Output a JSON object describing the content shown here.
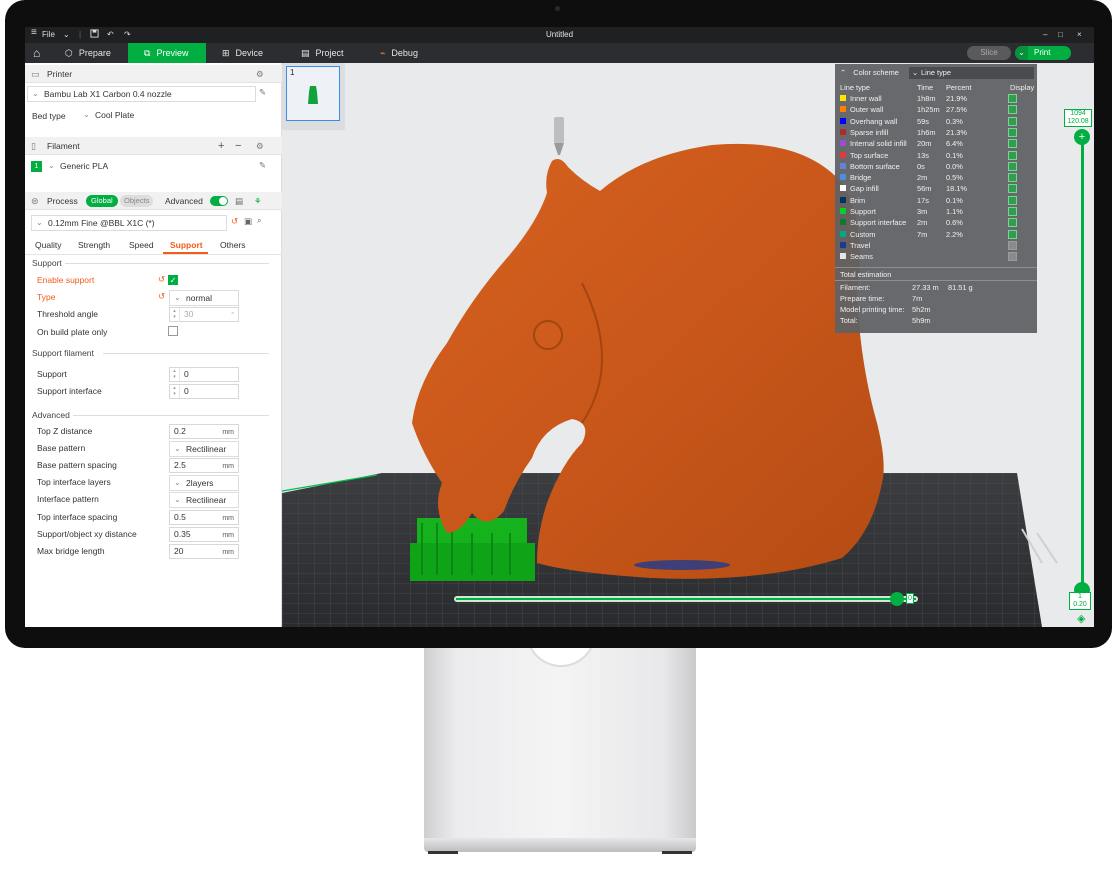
{
  "window": {
    "title": "Untitled",
    "file_menu": "File"
  },
  "nav": {
    "tabs": [
      {
        "label": "Prepare",
        "icon": "cube-icon"
      },
      {
        "label": "Preview",
        "icon": "layers-icon",
        "active": true
      },
      {
        "label": "Device",
        "icon": "device-icon"
      },
      {
        "label": "Project",
        "icon": "project-icon"
      },
      {
        "label": "Debug",
        "icon": "debug-icon"
      }
    ],
    "slice_label": "Slice",
    "print_label": "Print"
  },
  "printer": {
    "section_label": "Printer",
    "model": "Bambu Lab X1 Carbon 0.4 nozzle",
    "bed_type_label": "Bed type",
    "bed_type_value": "Cool Plate"
  },
  "filament": {
    "section_label": "Filament",
    "slot_number": "1",
    "name": "Generic PLA"
  },
  "process": {
    "section_label": "Process",
    "toggle_global": "Global",
    "toggle_objects": "Objects",
    "advanced_label": "Advanced",
    "preset": "0.12mm Fine @BBL X1C (*)",
    "tabs": [
      "Quality",
      "Strength",
      "Speed",
      "Support",
      "Others"
    ],
    "active_tab": "Support"
  },
  "support_group": {
    "title": "Support",
    "enable_support_label": "Enable support",
    "type_label": "Type",
    "type_value": "normal",
    "threshold_label": "Threshold angle",
    "threshold_value": "30",
    "build_plate_only_label": "On build plate only"
  },
  "support_filament_group": {
    "title": "Support filament",
    "support_label": "Support",
    "support_value": "0",
    "interface_label": "Support interface",
    "interface_value": "0"
  },
  "advanced_group": {
    "title": "Advanced",
    "rows": [
      {
        "label": "Top Z distance",
        "value": "0.2",
        "unit": "mm",
        "kind": "field"
      },
      {
        "label": "Base pattern",
        "value": "Rectilinear",
        "unit": "",
        "kind": "combo"
      },
      {
        "label": "Base pattern spacing",
        "value": "2.5",
        "unit": "mm",
        "kind": "field"
      },
      {
        "label": "Top interface layers",
        "value": "2",
        "unit": "layers",
        "kind": "combo"
      },
      {
        "label": "Interface pattern",
        "value": "Rectilinear",
        "unit": "",
        "kind": "combo"
      },
      {
        "label": "Top interface spacing",
        "value": "0.5",
        "unit": "mm",
        "kind": "field"
      },
      {
        "label": "Support/object xy distance",
        "value": "0.35",
        "unit": "mm",
        "kind": "field"
      },
      {
        "label": "Max bridge length",
        "value": "20",
        "unit": "mm",
        "kind": "field"
      }
    ]
  },
  "plate_thumbnail": {
    "number": "1"
  },
  "legend": {
    "color_scheme_label": "Color scheme",
    "color_scheme_value": "Line type",
    "headers": {
      "type": "Line type",
      "time": "Time",
      "percent": "Percent",
      "display": "Display"
    },
    "rows": [
      {
        "name": "Inner wall",
        "time": "1h8m",
        "percent": "21.9%",
        "color": "#FFE600",
        "display": true
      },
      {
        "name": "Outer wall",
        "time": "1h25m",
        "percent": "27.5%",
        "color": "#FF7F00",
        "display": true
      },
      {
        "name": "Overhang wall",
        "time": "59s",
        "percent": "0.3%",
        "color": "#0000FF",
        "display": true
      },
      {
        "name": "Sparse infill",
        "time": "1h6m",
        "percent": "21.3%",
        "color": "#B02A2A",
        "display": true
      },
      {
        "name": "Internal solid infill",
        "time": "20m",
        "percent": "6.4%",
        "color": "#9A4FD0",
        "display": true
      },
      {
        "name": "Top surface",
        "time": "13s",
        "percent": "0.1%",
        "color": "#E23A3A",
        "display": true
      },
      {
        "name": "Bottom surface",
        "time": "0s",
        "percent": "0.0%",
        "color": "#6A7FD8",
        "display": true
      },
      {
        "name": "Bridge",
        "time": "2m",
        "percent": "0.5%",
        "color": "#4F8FE0",
        "display": true
      },
      {
        "name": "Gap infill",
        "time": "56m",
        "percent": "18.1%",
        "color": "#FFFFFF",
        "display": true
      },
      {
        "name": "Brim",
        "time": "17s",
        "percent": "0.1%",
        "color": "#003366",
        "display": true
      },
      {
        "name": "Support",
        "time": "3m",
        "percent": "1.1%",
        "color": "#00D22A",
        "display": true
      },
      {
        "name": "Support interface",
        "time": "2m",
        "percent": "0.6%",
        "color": "#0F7A2A",
        "display": true
      },
      {
        "name": "Custom",
        "time": "7m",
        "percent": "2.2%",
        "color": "#00A88A",
        "display": true
      },
      {
        "name": "Travel",
        "time": "",
        "percent": "",
        "color": "#1A3B8F",
        "display": false
      },
      {
        "name": "Seams",
        "time": "",
        "percent": "",
        "color": "#E6E6E6",
        "display": false
      }
    ],
    "total_title": "Total estimation",
    "filament_label": "Filament:",
    "filament_length": "27.33 m",
    "filament_weight": "81.51 g",
    "prepare_label": "Prepare time:",
    "prepare_value": "7m",
    "model_time_label": "Model printing time:",
    "model_time_value": "5h2m",
    "total_label": "Total:",
    "total_value": "5h9m"
  },
  "layer_slider": {
    "top_layer": "1094",
    "top_height": "120.08",
    "bottom_layer": "1",
    "bottom_height": "0.20"
  },
  "move_slider": {
    "value": "0"
  },
  "colors": {
    "accent": "#00AE42",
    "warning": "#F25C19",
    "model": "#C9571A"
  }
}
